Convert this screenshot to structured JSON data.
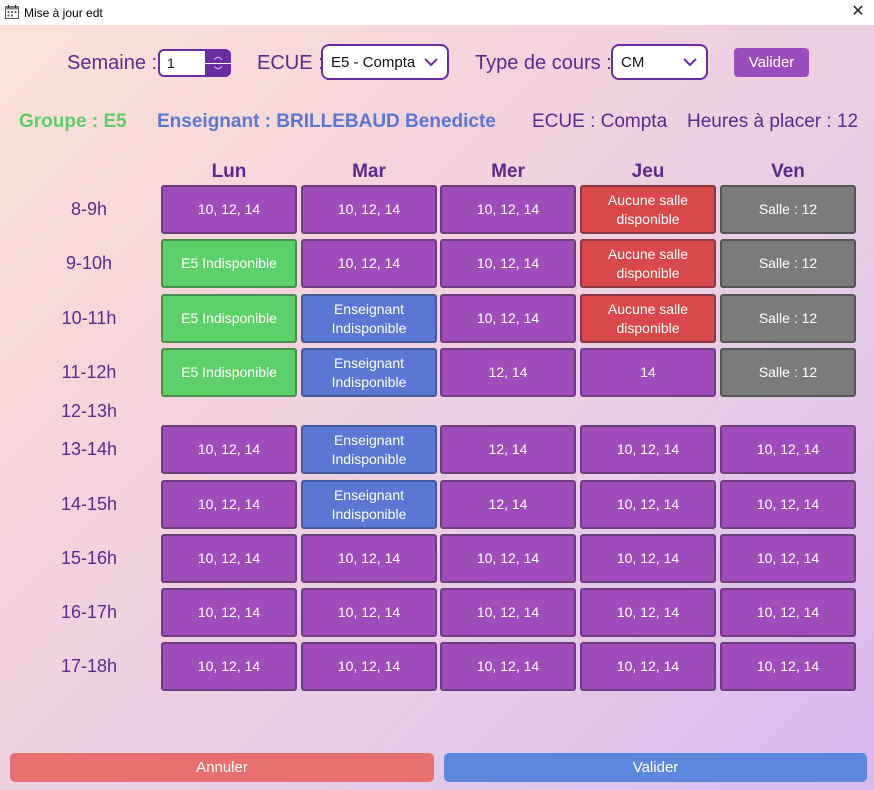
{
  "window": {
    "title": "Mise à jour edt",
    "close_icon": "close-icon"
  },
  "toolbar": {
    "semaine_label": "Semaine :",
    "semaine_value": "1",
    "ecue_label": "ECUE :",
    "ecue_value": "E5 - Compta",
    "type_label": "Type de cours :",
    "type_value": "CM",
    "valider_label": "Valider"
  },
  "info": {
    "groupe": "Groupe : E5",
    "enseignant": "Enseignant : BRILLEBAUD Benedicte",
    "ecue": "ECUE : Compta",
    "heures": "Heures à placer : 12"
  },
  "colors": {
    "purple": "#a04cbb",
    "green": "#5dd06a",
    "blue": "#5b77d3",
    "red": "#d9484a",
    "gray": "#7b7b7b",
    "heading": "#5a2a8e",
    "groupe": "#5dcd68",
    "enseignant": "#5b77d3"
  },
  "schedule": {
    "days": [
      "Lun",
      "Mar",
      "Mer",
      "Jeu",
      "Ven"
    ],
    "hours": [
      "8-9h",
      "9-10h",
      "10-11h",
      "11-12h",
      "12-13h",
      "13-14h",
      "14-15h",
      "15-16h",
      "16-17h",
      "17-18h"
    ],
    "rows": [
      [
        {
          "text": "10, 12, 14",
          "color": "purple"
        },
        {
          "text": "10, 12, 14",
          "color": "purple"
        },
        {
          "text": "10, 12, 14",
          "color": "purple"
        },
        {
          "text": "Aucune salle disponible",
          "color": "red"
        },
        {
          "text": "Salle : 12",
          "color": "gray"
        }
      ],
      [
        {
          "text": "E5 Indisponible",
          "color": "green"
        },
        {
          "text": "10, 12, 14",
          "color": "purple"
        },
        {
          "text": "10, 12, 14",
          "color": "purple"
        },
        {
          "text": "Aucune salle disponible",
          "color": "red"
        },
        {
          "text": "Salle : 12",
          "color": "gray"
        }
      ],
      [
        {
          "text": "E5 Indisponible",
          "color": "green"
        },
        {
          "text": "Enseignant Indisponible",
          "color": "blue"
        },
        {
          "text": "10, 12, 14",
          "color": "purple"
        },
        {
          "text": "Aucune salle disponible",
          "color": "red"
        },
        {
          "text": "Salle : 12",
          "color": "gray"
        }
      ],
      [
        {
          "text": "E5 Indisponible",
          "color": "green"
        },
        {
          "text": "Enseignant Indisponible",
          "color": "blue"
        },
        {
          "text": "12, 14",
          "color": "purple"
        },
        {
          "text": "14",
          "color": "purple"
        },
        {
          "text": "Salle : 12",
          "color": "gray"
        }
      ],
      [],
      [
        {
          "text": "10, 12, 14",
          "color": "purple"
        },
        {
          "text": "Enseignant Indisponible",
          "color": "blue"
        },
        {
          "text": "12, 14",
          "color": "purple"
        },
        {
          "text": "10, 12, 14",
          "color": "purple"
        },
        {
          "text": "10, 12, 14",
          "color": "purple"
        }
      ],
      [
        {
          "text": "10, 12, 14",
          "color": "purple"
        },
        {
          "text": "Enseignant Indisponible",
          "color": "blue"
        },
        {
          "text": "12, 14",
          "color": "purple"
        },
        {
          "text": "10, 12, 14",
          "color": "purple"
        },
        {
          "text": "10, 12, 14",
          "color": "purple"
        }
      ],
      [
        {
          "text": "10, 12, 14",
          "color": "purple"
        },
        {
          "text": "10, 12, 14",
          "color": "purple"
        },
        {
          "text": "10, 12, 14",
          "color": "purple"
        },
        {
          "text": "10, 12, 14",
          "color": "purple"
        },
        {
          "text": "10, 12, 14",
          "color": "purple"
        }
      ],
      [
        {
          "text": "10, 12, 14",
          "color": "purple"
        },
        {
          "text": "10, 12, 14",
          "color": "purple"
        },
        {
          "text": "10, 12, 14",
          "color": "purple"
        },
        {
          "text": "10, 12, 14",
          "color": "purple"
        },
        {
          "text": "10, 12, 14",
          "color": "purple"
        }
      ],
      [
        {
          "text": "10, 12, 14",
          "color": "purple"
        },
        {
          "text": "10, 12, 14",
          "color": "purple"
        },
        {
          "text": "10, 12, 14",
          "color": "purple"
        },
        {
          "text": "10, 12, 14",
          "color": "purple"
        },
        {
          "text": "10, 12, 14",
          "color": "purple"
        }
      ]
    ]
  },
  "footer": {
    "annuler_label": "Annuler",
    "valider_label": "Valider"
  }
}
